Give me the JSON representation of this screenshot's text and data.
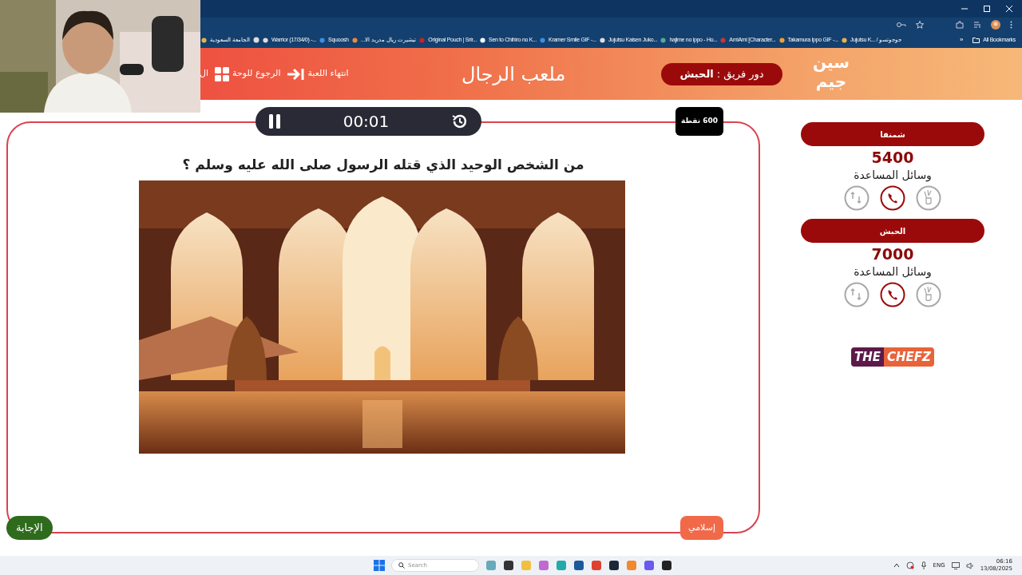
{
  "first_bookmark": "الجامعة السعودية",
  "bookmarks": [
    {
      "label": "Jujutsu K... / جوجوتسو"
    },
    {
      "label": "Takamura Ippo GIF -..."
    },
    {
      "label": "AmiAmi [Character..."
    },
    {
      "label": "hajime no ippo - Ho..."
    },
    {
      "label": "Jujutsu Kaisen Juko..."
    },
    {
      "label": "Kramer Smile GIF -..."
    },
    {
      "label": "Sen to Chihiro no K..."
    },
    {
      "label": "Original Pouch | Srir..."
    },
    {
      "label": "تيشيرت ريال مدريد الا..."
    },
    {
      "label": "Squoosh"
    },
    {
      "label": "Warrior (17/34/0) -..."
    }
  ],
  "more_bookmarks": "»",
  "all_bookmarks": "All Bookmarks",
  "header": {
    "nav": [
      {
        "label": "انتهاء اللعبة",
        "kind": "end-game"
      },
      {
        "label": "الرجوع للوحة",
        "kind": "board"
      },
      {
        "label": "ال",
        "kind": "text"
      }
    ],
    "title": "ملعب الرجال",
    "turn": "دور فريق : **الحبش**",
    "logo": [
      "سين",
      "جيم"
    ]
  },
  "timer": {
    "time": "00:01"
  },
  "points": "600 نقطة",
  "question": "من الشخص الوحيد الذي قتله الرسول صلى الله عليه وسلم ؟",
  "answer_button": "الإجابة",
  "category": "إسلامي",
  "teams": [
    {
      "name": "شمنقا",
      "score": "5400",
      "aids_label": "وسائل المساعدة",
      "aids": [
        {
          "kind": "two-answers",
          "used": true
        },
        {
          "kind": "call",
          "used": false
        },
        {
          "kind": "swap",
          "used": true
        }
      ]
    },
    {
      "name": "الحبش",
      "score": "7000",
      "aids_label": "وسائل المساعدة",
      "aids": [
        {
          "kind": "two-answers",
          "used": true
        },
        {
          "kind": "call",
          "used": false
        },
        {
          "kind": "swap",
          "used": true
        }
      ]
    }
  ],
  "sponsor": {
    "left": "THE",
    "right": "CHEFZ"
  },
  "taskbar": {
    "search_placeholder": "Search",
    "language": "ENG",
    "time": "06:16",
    "date": "13/08/2025"
  }
}
